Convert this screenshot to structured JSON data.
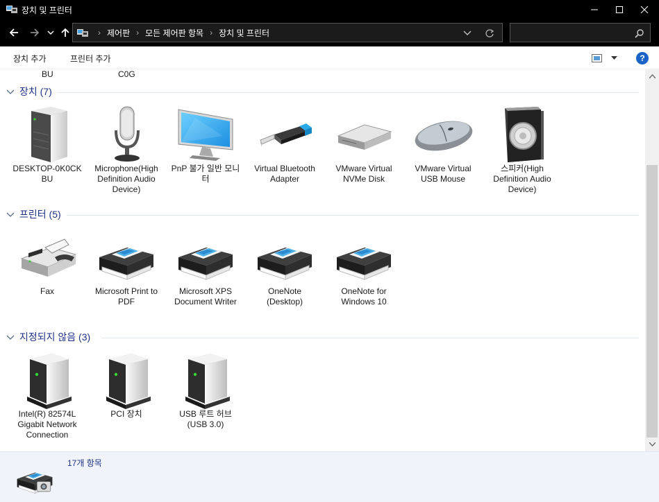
{
  "window": {
    "title": "장치 및 프린터",
    "minimize_glyph": "—",
    "maximize_glyph": "☐",
    "close_glyph": "✕"
  },
  "nav": {
    "back_icon": "arrow-left-icon",
    "forward_icon": "arrow-right-icon",
    "recent_icon": "chevron-down-icon",
    "up_icon": "arrow-up-icon",
    "breadcrumbs": [
      "제어판",
      "모든 제어판 항목",
      "장치 및 프린터"
    ],
    "refresh_icon": "refresh-icon",
    "search_placeholder": ""
  },
  "commands": {
    "add_device": "장치 추가",
    "add_printer": "프린터 추가"
  },
  "partial_row": [
    "BU",
    "C0G"
  ],
  "groups": {
    "devices": {
      "header": "장치 (7)",
      "items": [
        {
          "label": "DESKTOP-0K0CK BU",
          "icon": "computer-tower-icon"
        },
        {
          "label": "Microphone(High Definition Audio Device)",
          "icon": "microphone-icon"
        },
        {
          "label": "PnP 불가 일반 모니터",
          "icon": "monitor-icon"
        },
        {
          "label": "Virtual Bluetooth Adapter",
          "icon": "usb-dongle-icon"
        },
        {
          "label": "VMware Virtual NVMe Disk",
          "icon": "disk-drive-icon"
        },
        {
          "label": "VMware Virtual USB Mouse",
          "icon": "mouse-icon"
        },
        {
          "label": "스피커(High Definition Audio Device)",
          "icon": "speaker-icon"
        }
      ]
    },
    "printers": {
      "header": "프린터 (5)",
      "items": [
        {
          "label": "Fax",
          "icon": "fax-icon"
        },
        {
          "label": "Microsoft Print to PDF",
          "icon": "printer-icon"
        },
        {
          "label": "Microsoft XPS Document Writer",
          "icon": "printer-icon"
        },
        {
          "label": "OneNote (Desktop)",
          "icon": "printer-icon"
        },
        {
          "label": "OneNote for Windows 10",
          "icon": "printer-icon"
        }
      ]
    },
    "unspecified": {
      "header": "지정되지 않음 (3)",
      "items": [
        {
          "label": "Intel(R) 82574L Gigabit Network Connection",
          "icon": "server-box-icon"
        },
        {
          "label": "PCI 장치",
          "icon": "server-box-icon"
        },
        {
          "label": "USB 루트 허브 (USB 3.0)",
          "icon": "server-box-icon"
        }
      ]
    }
  },
  "status": {
    "count": "17개 항목"
  },
  "colors": {
    "group_header": "#1e3287",
    "titlebar": "#000000",
    "details_bg": "#f0f4fa"
  }
}
